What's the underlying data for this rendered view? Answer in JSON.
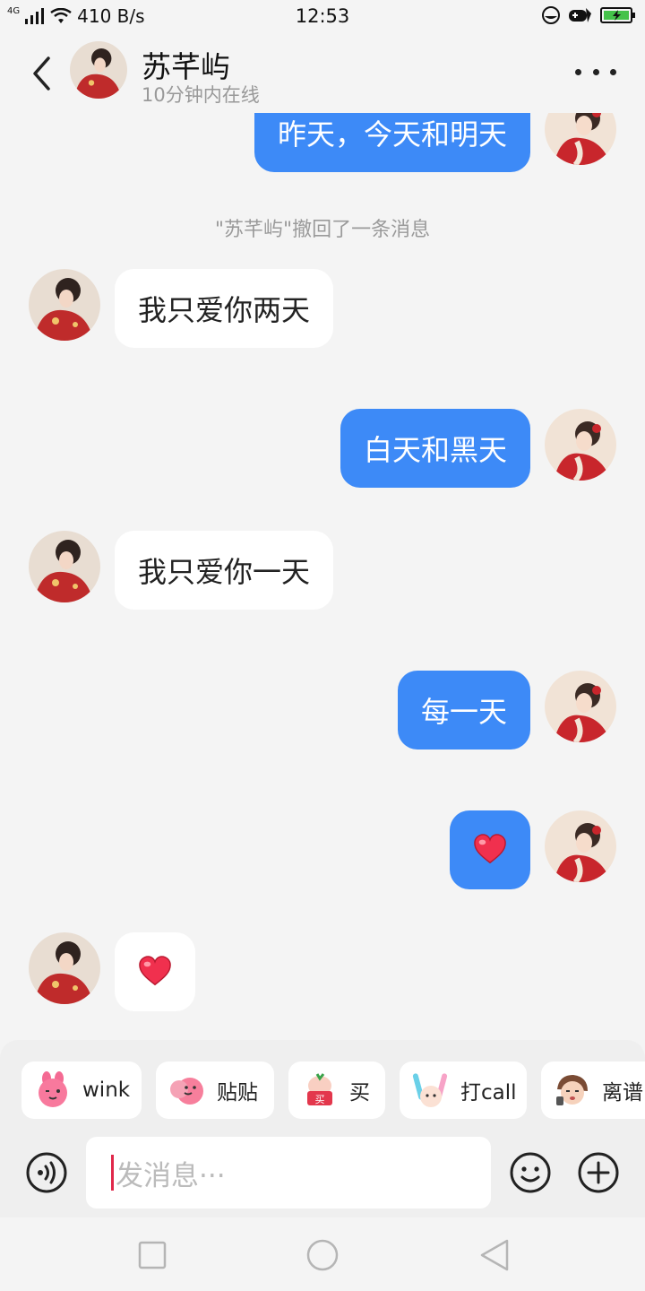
{
  "status_bar": {
    "network_type": "4G",
    "speed": "410 B/s",
    "time": "12:53"
  },
  "header": {
    "contact_name": "苏芊屿",
    "contact_status": "10分钟内在线"
  },
  "messages": [
    {
      "side": "out",
      "text": "昨天，今天和明天"
    },
    {
      "side": "system",
      "text": "\"苏芊屿\"撤回了一条消息"
    },
    {
      "side": "in",
      "text": "我只爱你两天"
    },
    {
      "side": "out",
      "text": "白天和黑天"
    },
    {
      "side": "in",
      "text": "我只爱你一天"
    },
    {
      "side": "out",
      "text": "每一天"
    },
    {
      "side": "out",
      "emoji": "heart"
    },
    {
      "side": "in",
      "emoji": "heart"
    }
  ],
  "quick_stickers": [
    {
      "label": "wink",
      "icon": "wink-sticker-icon"
    },
    {
      "label": "贴贴",
      "icon": "hug-sticker-icon"
    },
    {
      "label": "买",
      "icon": "buy-sticker-icon"
    },
    {
      "label": "打call",
      "icon": "cheer-sticker-icon"
    },
    {
      "label": "离谱",
      "icon": "outrageous-sticker-icon"
    }
  ],
  "input": {
    "placeholder": "发消息···"
  },
  "colors": {
    "background": "#f4f4f4",
    "outgoing_bubble": "#3d8af7",
    "incoming_bubble": "#ffffff",
    "caret": "#e0284a",
    "heart": "#f0304e"
  }
}
